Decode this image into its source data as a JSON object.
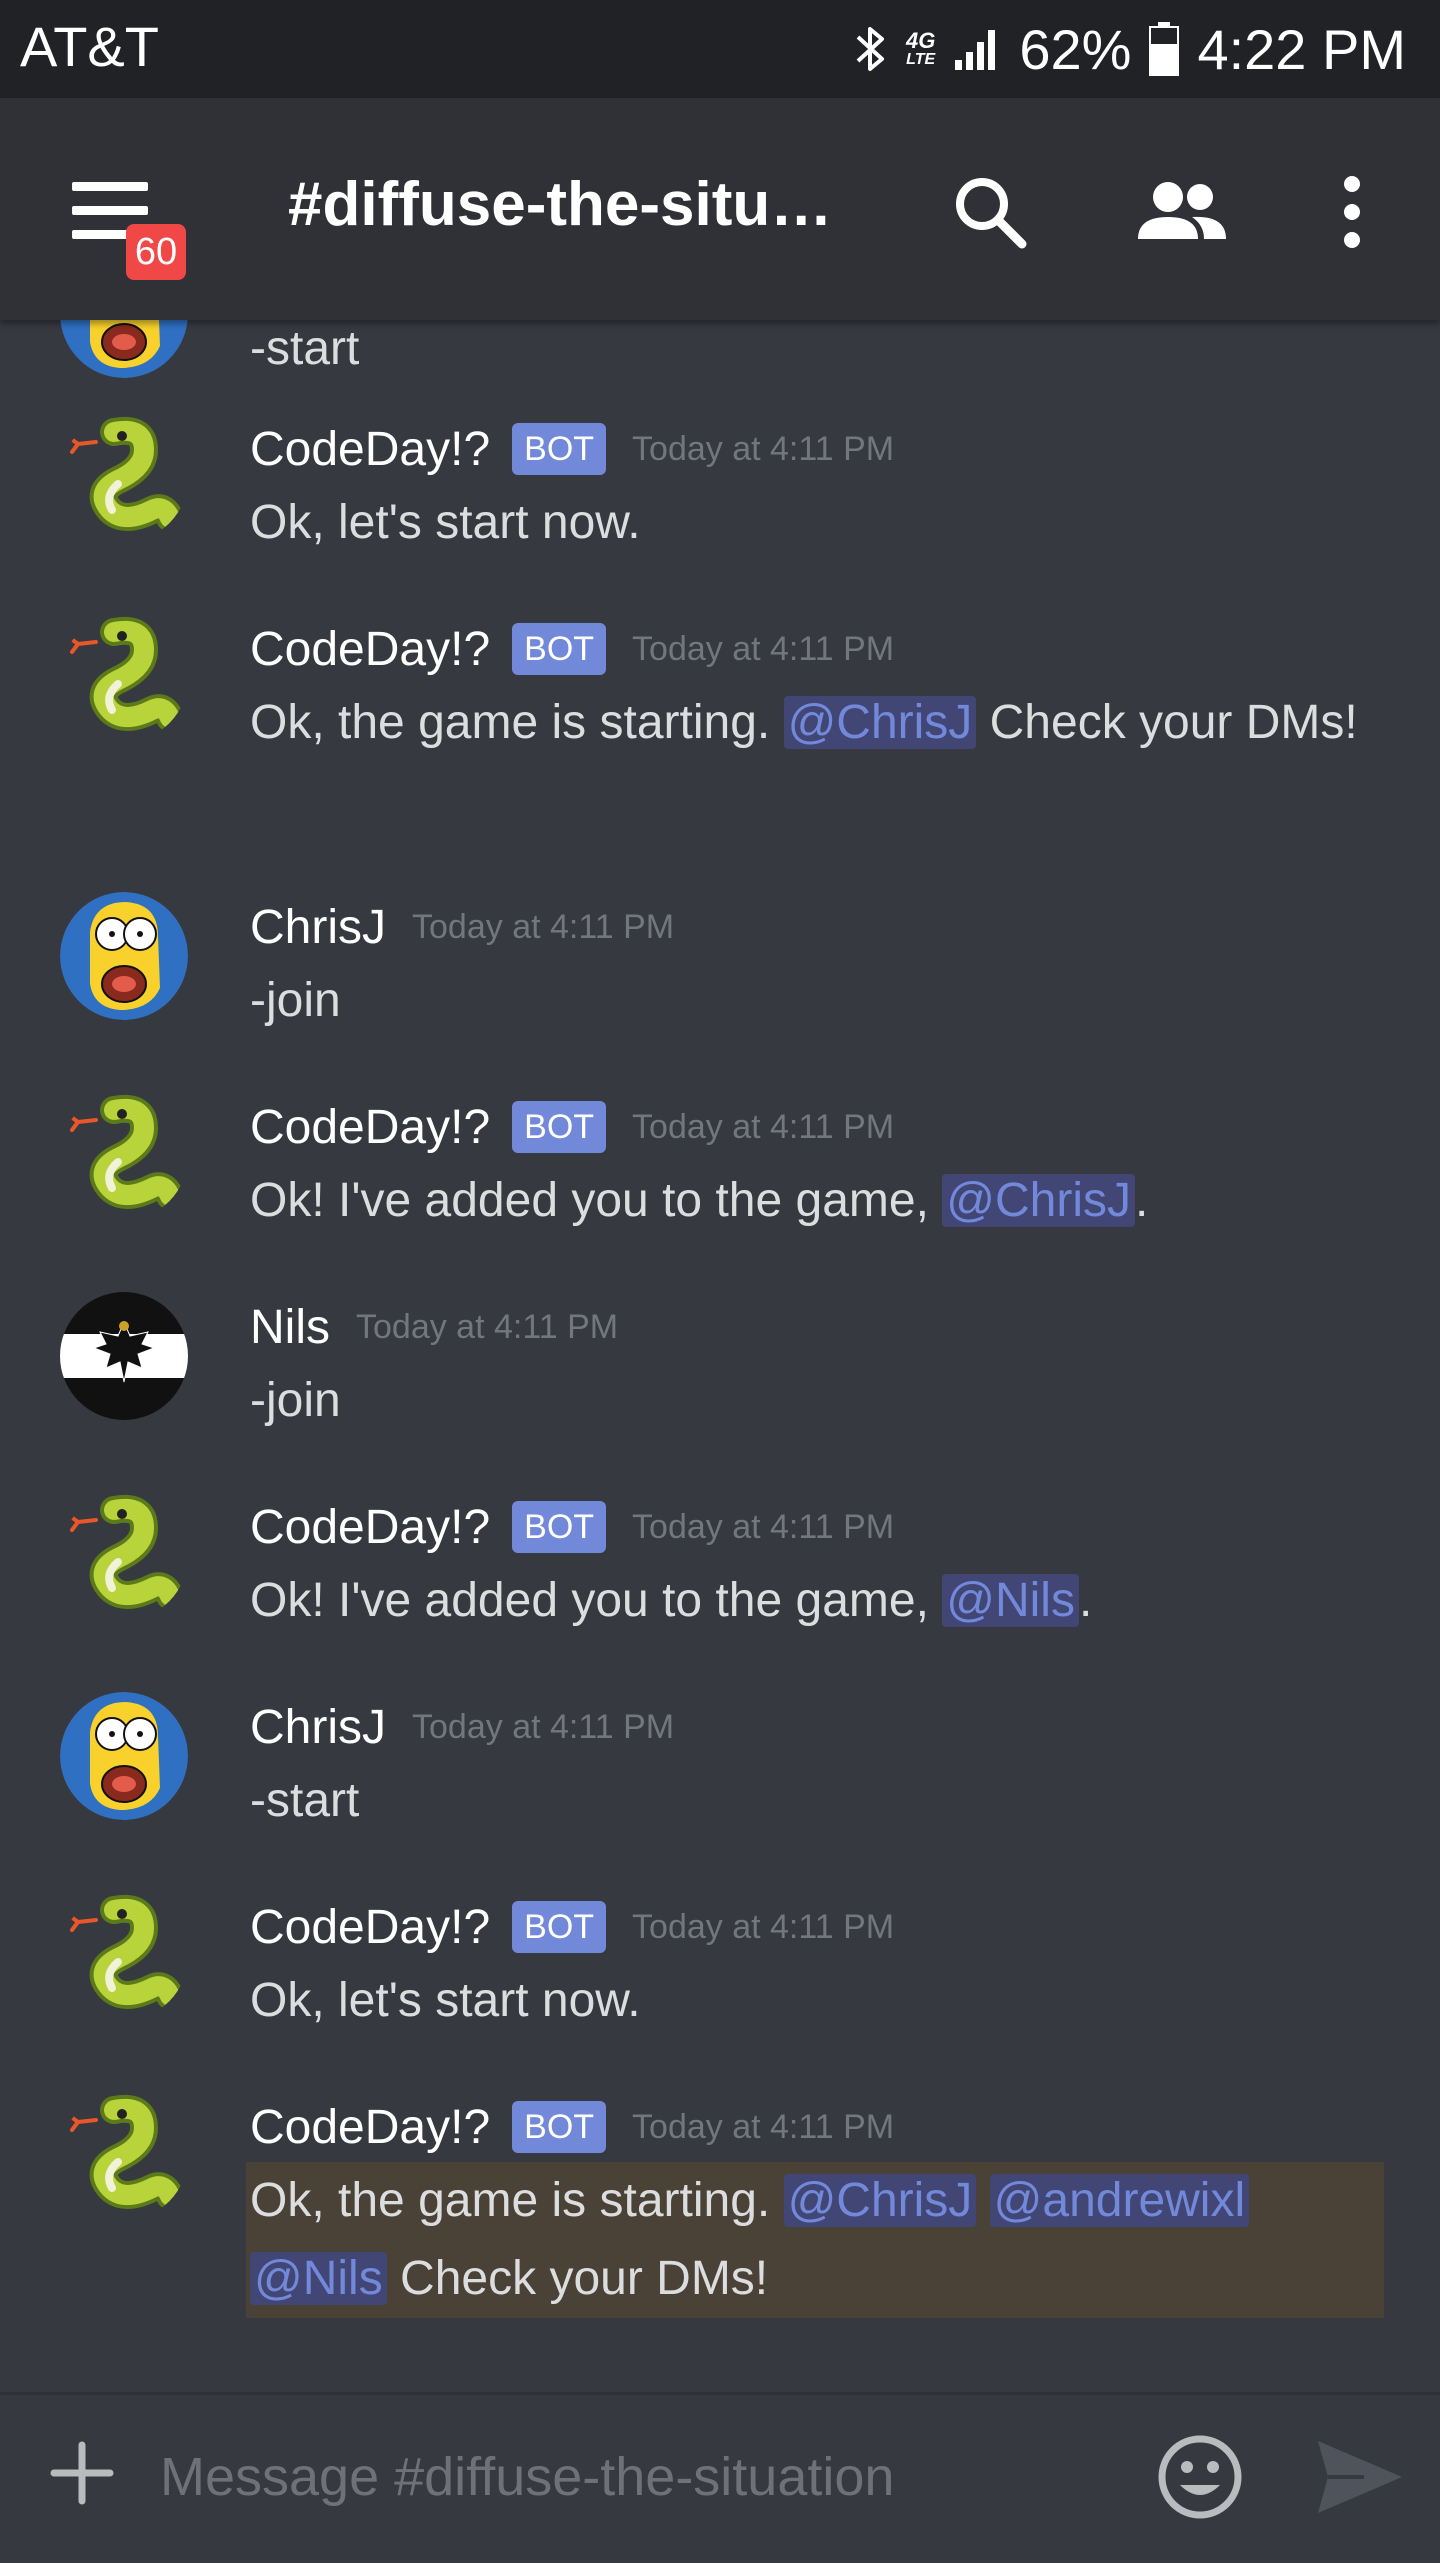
{
  "status_bar": {
    "carrier": "AT&T",
    "network": "4G",
    "network_sub": "LTE",
    "battery": "62%",
    "time": "4:22 PM"
  },
  "toolbar": {
    "unread_badge": "60",
    "channel_title": "#diffuse-the-situ…"
  },
  "colors": {
    "background": "#36393f",
    "mention": "#7289da",
    "bot_tag": "#7289da",
    "badge": "#f04747",
    "highlight": "#4b4237"
  },
  "messages": [
    {
      "author": "",
      "content": "-start",
      "avatar": "homer-avatar"
    },
    {
      "author": "CodeDay!?",
      "bot": "BOT",
      "timestamp": "Today at 4:11 PM",
      "content": "Ok, let's start now.",
      "avatar": "snake-avatar"
    },
    {
      "author": "CodeDay!?",
      "bot": "BOT",
      "timestamp": "Today at 4:11 PM",
      "content_pre": "Ok, the game is starting. ",
      "mention1": "@ChrisJ",
      "content_post": " Check your DMs!",
      "avatar": "snake-avatar"
    },
    {
      "author": "ChrisJ",
      "timestamp": "Today at 4:11 PM",
      "content": "-join",
      "avatar": "homer-avatar"
    },
    {
      "author": "CodeDay!?",
      "bot": "BOT",
      "timestamp": "Today at 4:11 PM",
      "content_pre": "Ok! I've added you to the game, ",
      "mention1": "@ChrisJ",
      "content_post": ".",
      "avatar": "snake-avatar"
    },
    {
      "author": "Nils",
      "timestamp": "Today at 4:11 PM",
      "content": "-join",
      "avatar": "eagle-flag-avatar"
    },
    {
      "author": "CodeDay!?",
      "bot": "BOT",
      "timestamp": "Today at 4:11 PM",
      "content_pre": "Ok! I've added you to the game, ",
      "mention1": "@Nils",
      "content_post": ".",
      "avatar": "snake-avatar"
    },
    {
      "author": "ChrisJ",
      "timestamp": "Today at 4:11 PM",
      "content": "-start",
      "avatar": "homer-avatar"
    },
    {
      "author": "CodeDay!?",
      "bot": "BOT",
      "timestamp": "Today at 4:11 PM",
      "content": "Ok, let's start now.",
      "avatar": "snake-avatar"
    },
    {
      "author": "CodeDay!?",
      "bot": "BOT",
      "timestamp": "Today at 4:11 PM",
      "content_pre": "Ok, the game is starting. ",
      "mention1": "@ChrisJ",
      "mention2": "@andrewixl",
      "mention3": "@Nils",
      "content_post": " Check your DMs!",
      "avatar": "snake-avatar"
    }
  ],
  "input": {
    "placeholder": "Message #diffuse-the-situation"
  }
}
